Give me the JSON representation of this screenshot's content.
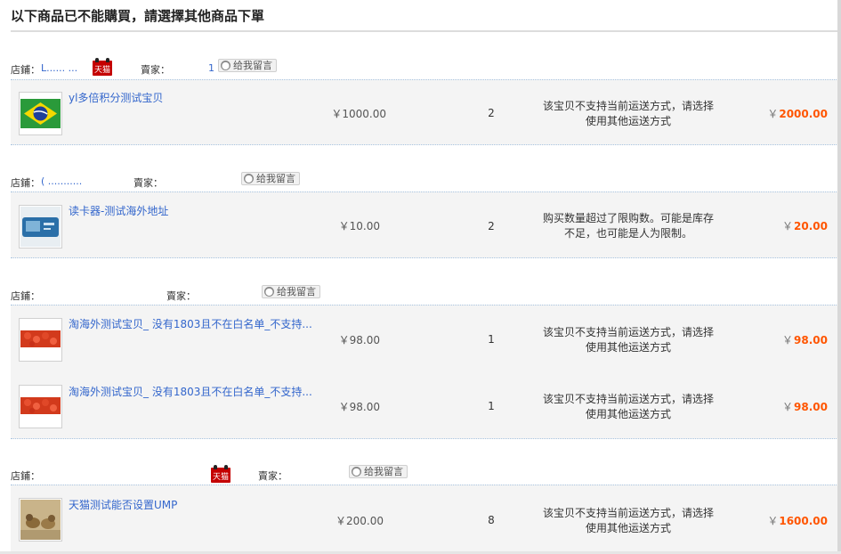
{
  "page_title": "以下商品已不能購買，請選擇其他商品下單",
  "labels": {
    "shop": "店鋪：",
    "seller": "賣家：",
    "message_btn": "给我留言",
    "tmall_badge": "天猫",
    "currency": "￥"
  },
  "groups": [
    {
      "shop_name": "L...... ...",
      "seller_name": "1",
      "tmall": true,
      "items": [
        {
          "name": "yl多倍积分测试宝贝",
          "price": "￥1000.00",
          "qty": "2",
          "reason": "该宝贝不支持当前运送方式，请选择使用其他运送方式",
          "total": "2000.00",
          "thumb": "brazil-flag"
        }
      ]
    },
    {
      "shop_name": "( ...........",
      "seller_name": "",
      "tmall": false,
      "items": [
        {
          "name": "读卡器-测试海外地址",
          "price": "￥10.00",
          "qty": "2",
          "reason": "购买数量超过了限购数。可能是库存不足，也可能是人为限制。",
          "total": "20.00",
          "thumb": "card-reader"
        }
      ]
    },
    {
      "shop_name": "",
      "seller_name": "",
      "tmall": false,
      "items": [
        {
          "name": "淘海外测试宝贝_ 没有1803且不在白名单_不支持...",
          "price": "￥98.00",
          "qty": "1",
          "reason": "该宝贝不支持当前运送方式，请选择使用其他运送方式",
          "total": "98.00",
          "thumb": "red-berries"
        },
        {
          "name": "淘海外测试宝贝_ 没有1803且不在白名单_不支持...",
          "price": "￥98.00",
          "qty": "1",
          "reason": "该宝贝不支持当前运送方式，请选择使用其他运送方式",
          "total": "98.00",
          "thumb": "red-berries"
        }
      ]
    },
    {
      "shop_name": "",
      "seller_name": "",
      "tmall": true,
      "items": [
        {
          "name": "天猫测试能否设置UMP",
          "price": "￥200.00",
          "qty": "8",
          "reason": "该宝贝不支持当前运送方式，请选择使用其他运送方式",
          "total": "1600.00",
          "thumb": "birds"
        }
      ]
    }
  ],
  "colors": {
    "link": "#3366cc",
    "total": "#ff5500",
    "row_bg": "#f4f4f4",
    "tmall_red": "#c40000"
  }
}
